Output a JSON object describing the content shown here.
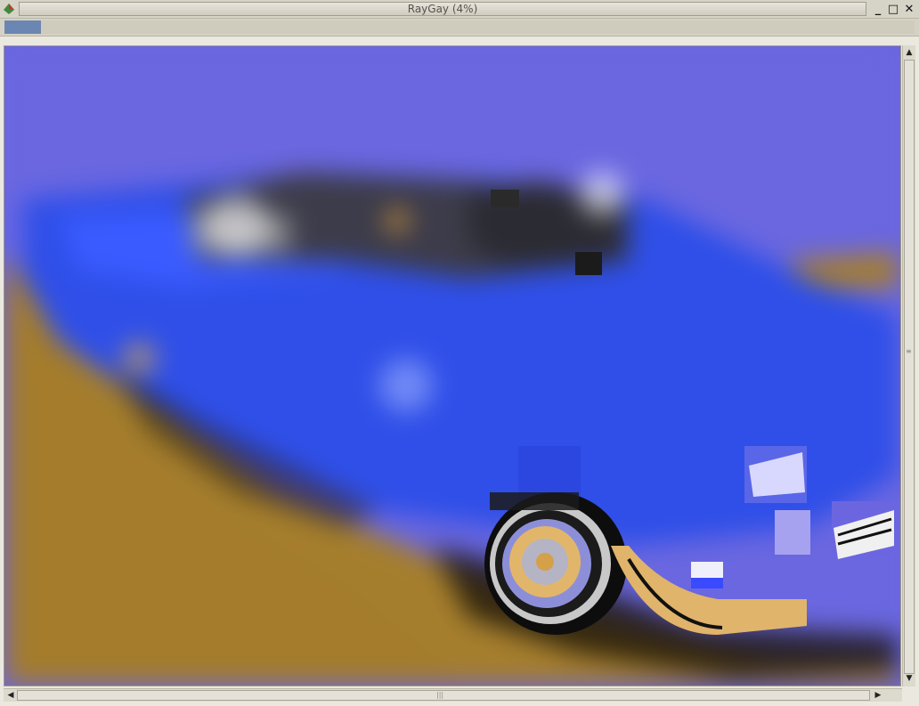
{
  "window": {
    "title": "RayGay (4%)"
  },
  "progress": {
    "fraction": 0.04
  },
  "colors": {
    "sky": "#6a67e0",
    "ground": "#a57e2d",
    "car_body": "#2f4fe8",
    "progress_fill": "#6b86b2"
  },
  "icons": {
    "app": "raygay-app-icon",
    "minimize": "minimize-icon",
    "maximize": "maximize-icon",
    "close": "close-icon"
  },
  "glyphs": {
    "minimize": "_",
    "maximize": "□",
    "close": "✕",
    "arrow_up": "▲",
    "arrow_down": "▼",
    "arrow_left": "◀",
    "arrow_right": "▶",
    "grip_v": "≡",
    "grip_h": "|||"
  }
}
